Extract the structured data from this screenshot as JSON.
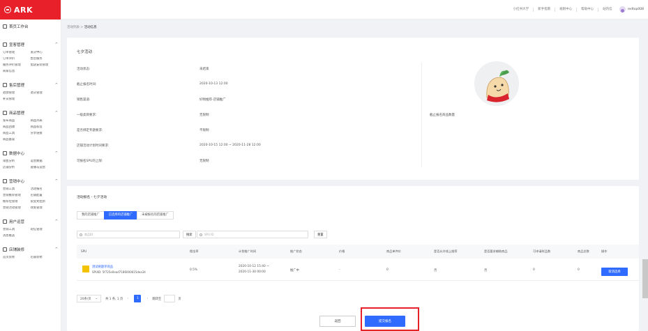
{
  "sidebar": {
    "logo": "ARK",
    "home": "首页工作台",
    "groups": [
      {
        "title": "宣客管理",
        "items": [
          "订单管理",
          "发货中心",
          "订单评价",
          "售后服务",
          "服务评价管理",
          "配送安装管理",
          "商家信息"
        ]
      },
      {
        "title": "售后管理",
        "items": [
          "退款管理",
          "退货管理",
          "补货管理"
        ]
      },
      {
        "title": "商品管理",
        "items": [
          "发布商品",
          "商品列表",
          "商品回收",
          "商品标签",
          "商品工具",
          "分享链接",
          "商品备案"
        ]
      },
      {
        "title": "数据中心",
        "items": [
          "销售分析",
          "运营数据",
          "店铺分析",
          "直播与运营"
        ]
      },
      {
        "title": "营销中心",
        "items": [
          "营销工具",
          "活动报名",
          "营销推荐管理",
          "店铺配置",
          "推荐位管理",
          "裂变式拉新",
          "营销活动管理",
          "政策管理"
        ]
      },
      {
        "title": "用户运营",
        "items": [
          "营销工具",
          "短信管理",
          "消息推送"
        ]
      },
      {
        "title": "店铺装修",
        "items": [
          "首页装修",
          "店铺装修"
        ]
      }
    ]
  },
  "topbar": {
    "links": [
      "小红书大学",
      "新手指南",
      "规则中心",
      "帮助中心",
      "站内信"
    ],
    "username": "redtop008"
  },
  "breadcrumb": {
    "parent": "活动列表",
    "separator": " > ",
    "current": "活动信息"
  },
  "info": {
    "title": "七夕活动",
    "rows": [
      {
        "label": "活动状态:",
        "value": "未结束"
      },
      {
        "label": "截止报名时间:",
        "value": "2020-10-13 12:00"
      },
      {
        "label": "销售渠道:",
        "value": "好物推荐-店铺推广"
      },
      {
        "label": "一级类目要求:",
        "value": "无限制"
      },
      {
        "label": "是否绑定专题要求:",
        "value": "不限制"
      },
      {
        "label": "店铺活动计划时间要求:",
        "value": "2020-10-15 12:00 ~ 2020-11-28 12:00"
      },
      {
        "label": "可报名SPU的上限:",
        "value": "无限制"
      }
    ],
    "store_name": "截止报名商品数量"
  },
  "table": {
    "activity_title": "活动报名 - 七夕活动",
    "tabs": [
      "我的店铺推广",
      "已选择的店铺推广",
      "未被报名的店铺推广"
    ],
    "active_tab": 1,
    "search1_placeholder": "商品ID",
    "search_btn": "搜索",
    "search2_placeholder": "SPU ID",
    "reset_btn": "重置",
    "columns": [
      "SPU",
      "佣金率",
      "计划推广时间",
      "推广状态",
      "价格",
      "商品单件价",
      "是否允许线上推荐",
      "是否要求辅助商品",
      "可申请样品数",
      "商品总数",
      "操作"
    ],
    "rows": [
      {
        "name": "测试刷题单商品",
        "spuid": "SPUID: 5f725e0ead7186000615dea34",
        "commission": "0.5%",
        "plan_time_1": "2020-10-12 15:40 ~",
        "plan_time_2": "2020-11-30 00:00",
        "status": "推广中",
        "price": "-",
        "unit_price": "0",
        "allow_online": "否",
        "require_aux": "否",
        "samples": "0",
        "total": "0",
        "action": "取消选择"
      }
    ],
    "pager": {
      "size": "20条/页",
      "total": "共 1 条, 1 页",
      "current": "1",
      "goto_label": "跳转至",
      "goto_suffix": "页"
    },
    "back_btn": "返回",
    "submit_btn": "提交报名"
  }
}
